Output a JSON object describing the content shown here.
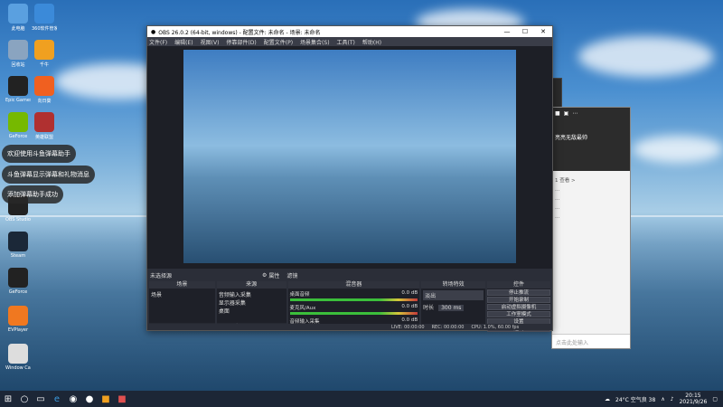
{
  "desktop": {
    "icons": [
      {
        "label": "此电脑",
        "icon": "computer-icon",
        "color": "#5aa0e0"
      },
      {
        "label": "360软件管家",
        "icon": "app-store-icon",
        "color": "#3b8ad9"
      },
      {
        "label": "回收站",
        "icon": "recycle-bin-icon",
        "color": "#8aa4c0"
      },
      {
        "label": "千牛",
        "icon": "qianniu-icon",
        "color": "#f0a020"
      },
      {
        "label": "Epic Games Launcher",
        "icon": "epic-icon",
        "color": "#222222"
      },
      {
        "label": "向日葵",
        "icon": "sunflower-icon",
        "color": "#f06020"
      },
      {
        "label": "GeForce",
        "icon": "nvidia-icon",
        "color": "#76b900"
      },
      {
        "label": "英雄联盟",
        "icon": "lol-icon",
        "color": "#b03030"
      },
      {
        "label": "OBS Studio",
        "icon": "obs-icon",
        "color": "#222222"
      },
      {
        "label": "Steam",
        "icon": "steam-icon",
        "color": "#1b2838"
      },
      {
        "label": "GeForce",
        "icon": "g-hub-icon",
        "color": "#222222"
      },
      {
        "label": "EVPlayer",
        "icon": "evplayer-icon",
        "color": "#f07820"
      },
      {
        "label": "Window Camera",
        "icon": "camera-icon",
        "color": "#dddddd"
      }
    ],
    "toasts": [
      "欢迎使用斗鱼弹幕助手",
      "斗鱼弹幕显示弹幕和礼物消息",
      "添加弹幕助手成功"
    ]
  },
  "obs": {
    "title": "OBS 26.0.2 (64-bit, windows) - 配置文件: 未命名 - 场景: 未命名",
    "menu": [
      "文件(F)",
      "编辑(E)",
      "视图(V)",
      "停靠部件(D)",
      "配置文件(P)",
      "场景集合(S)",
      "工具(T)",
      "帮助(H)"
    ],
    "scene_bar": {
      "label": "未选择源",
      "props": "属性",
      "filters": "滤镜"
    },
    "docks": {
      "scenes": {
        "header": "场景",
        "items": [
          "场景"
        ]
      },
      "sources": {
        "header": "来源",
        "items": [
          "音频输入采集",
          "显示器采集",
          "桌面"
        ]
      },
      "mixer": {
        "header": "混音器",
        "channels": [
          {
            "name": "桌面音频",
            "db": "0.0 dB"
          },
          {
            "name": "麦克风/Aux",
            "db": "0.0 dB"
          },
          {
            "name": "音频输入采集",
            "db": "0.0 dB"
          }
        ]
      },
      "transitions": {
        "header": "转场特效",
        "type": "淡出",
        "duration_label": "时长",
        "duration": "300 ms"
      },
      "controls": {
        "header": "控件",
        "buttons": [
          "停止推流",
          "开始录制",
          "启动虚拟摄像机",
          "工作室模式",
          "设置",
          "退出"
        ]
      }
    },
    "status": {
      "live": "LIVE: 00:00:00",
      "rec": "REC: 00:00:00",
      "cpu": "CPU: 1.0%, 60.00 fps"
    }
  },
  "qq": {
    "title": "亮亮无敌最帅",
    "list": [
      "1 查看 >",
      "...",
      "...",
      "...",
      "...",
      "...",
      "..."
    ],
    "input_placeholder": "点击此处输入"
  },
  "taskbar": {
    "weather": "24°C 空气良 38",
    "time": "20:15",
    "date": "2021/9/26"
  }
}
